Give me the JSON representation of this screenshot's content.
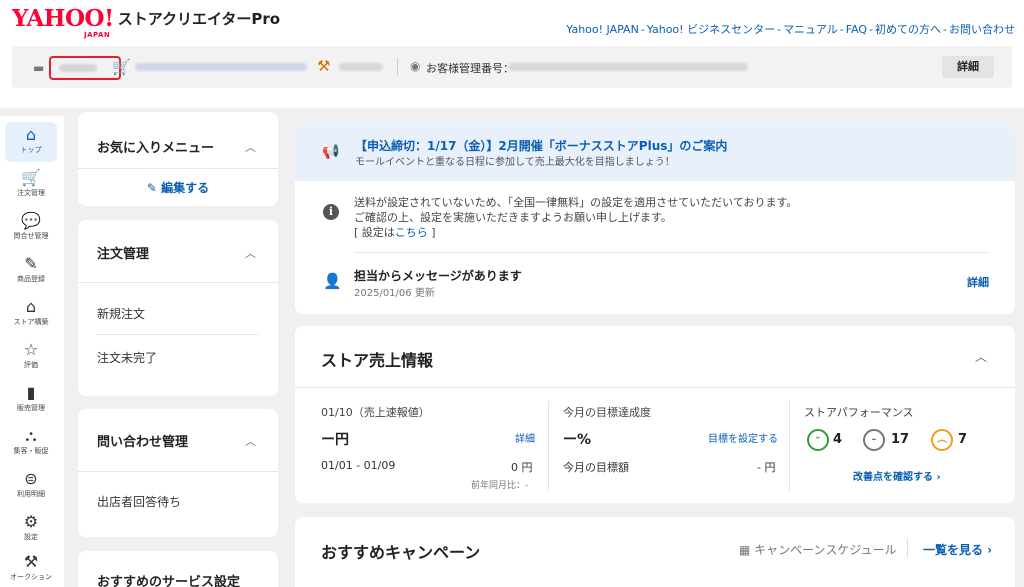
{
  "header": {
    "logo_main": "YAHOO!",
    "logo_sub": "JAPAN",
    "app_name": "ストアクリエイターPro",
    "links": [
      "Yahoo! JAPAN",
      "Yahoo! ビジネスセンター",
      "マニュアル",
      "FAQ",
      "初めての方へ",
      "お問い合わせ"
    ],
    "separator": "-"
  },
  "infobar": {
    "customer_no_label": "お客様管理番号：",
    "detail_label": "詳細"
  },
  "leftnav": {
    "items": [
      {
        "label": "トップ",
        "icon": "home-icon",
        "glyph": "⌂"
      },
      {
        "label": "注文管理",
        "icon": "cart-icon",
        "glyph": "🛒"
      },
      {
        "label": "問合せ管理",
        "icon": "chat-icon",
        "glyph": "💬"
      },
      {
        "label": "商品登録",
        "icon": "edit-icon",
        "glyph": "✎"
      },
      {
        "label": "ストア構築",
        "icon": "store-icon",
        "glyph": "⌂"
      },
      {
        "label": "評価",
        "icon": "star-icon",
        "glyph": "☆"
      },
      {
        "label": "販売管理",
        "icon": "bar-chart-icon",
        "glyph": "▮"
      },
      {
        "label": "集客・販促",
        "icon": "people-icon",
        "glyph": "⛬"
      },
      {
        "label": "利用明細",
        "icon": "billing-icon",
        "glyph": "⊜"
      },
      {
        "label": "設定",
        "icon": "gear-icon",
        "glyph": "⚙"
      },
      {
        "label": "オークション",
        "icon": "gavel-icon",
        "glyph": "⚒"
      }
    ]
  },
  "favorites": {
    "title": "お気に入りメニュー",
    "edit_label": "編集する"
  },
  "orders": {
    "title": "注文管理",
    "items": [
      "新規注文",
      "注文未完了"
    ]
  },
  "inquiries": {
    "title": "問い合わせ管理",
    "items": [
      "出店者回答待ち"
    ]
  },
  "recommended_services": {
    "title": "おすすめのサービス設定"
  },
  "notice": {
    "title": "【申込締切：1/17（金）】2月開催「ボーナスストアPlus」のご案内",
    "subtitle": "モールイベントと重なる日程に参加して売上最大化を目指しましょう！",
    "shipping_line1": "送料が設定されていないため、「全国一律無料」の設定を適用させていただいております。",
    "shipping_line2": "ご確認の上、設定を実施いただきますようお願い申し上げます。",
    "shipping_line3_prefix": "[ 設定は",
    "shipping_line3_link": "こちら",
    "shipping_line3_suffix": " ]",
    "message_title": "担当からメッセージがあります",
    "message_date": "2025/01/06 更新",
    "message_detail": "詳細"
  },
  "sales": {
    "title": "ストア売上情報",
    "daily_label": "01/10（売上速報値）",
    "daily_value": "ー円",
    "daily_detail": "詳細",
    "period_label": "01/01 - 01/09",
    "period_value": "0 円",
    "yoy_label": "前年同月比：-",
    "goal_label": "今月の目標達成度",
    "goal_value": "ー%",
    "goal_link": "目標を設定する",
    "goal_amount_label": "今月の目標額",
    "goal_amount_value": "- 円",
    "perf_label": "ストアパフォーマンス",
    "perf_good": "4",
    "perf_neutral": "17",
    "perf_bad": "7",
    "perf_link": "改善点を確認する ›"
  },
  "campaign": {
    "title": "おすすめキャンペーン",
    "schedule_label": "キャンペーンスケジュール",
    "see_all_label": "一覧を見る ›"
  },
  "colors": {
    "accent": "#0b5fb5",
    "brand_red": "#ff0033",
    "good": "#3a9a3a",
    "neutral": "#777777",
    "bad": "#e8a020"
  }
}
